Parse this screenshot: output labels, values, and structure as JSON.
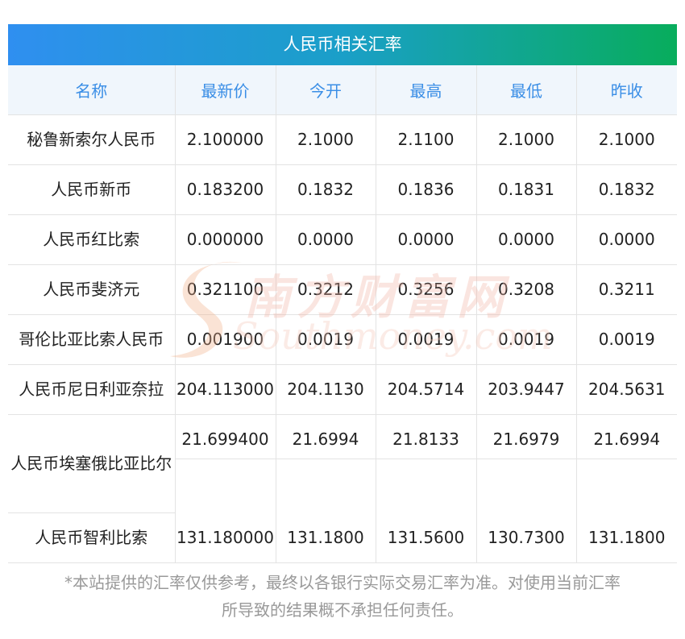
{
  "title": "人民币相关汇率",
  "columns": [
    "名称",
    "最新价",
    "今开",
    "最高",
    "最低",
    "昨收"
  ],
  "rows": [
    {
      "name": "秘鲁新索尔人民币",
      "latest": "2.100000",
      "open": "2.1000",
      "high": "2.1100",
      "low": "2.1000",
      "prev_close": "2.1000"
    },
    {
      "name": "人民币新币",
      "latest": "0.183200",
      "open": "0.1832",
      "high": "0.1836",
      "low": "0.1831",
      "prev_close": "0.1832"
    },
    {
      "name": "人民币红比索",
      "latest": "0.000000",
      "open": "0.0000",
      "high": "0.0000",
      "low": "0.0000",
      "prev_close": "0.0000"
    },
    {
      "name": "人民币斐济元",
      "latest": "0.321100",
      "open": "0.3212",
      "high": "0.3256",
      "low": "0.3208",
      "prev_close": "0.3211"
    },
    {
      "name": "哥伦比亚比索人民币",
      "latest": "0.001900",
      "open": "0.0019",
      "high": "0.0019",
      "low": "0.0019",
      "prev_close": "0.0019"
    },
    {
      "name": "人民币尼日利亚奈拉",
      "latest": "204.113000",
      "open": "204.1130",
      "high": "204.5714",
      "low": "203.9447",
      "prev_close": "204.5631"
    },
    {
      "name": "人民币埃塞俄比亚比尔",
      "latest": "21.699400",
      "open": "21.6994",
      "high": "21.8133",
      "low": "21.6979",
      "prev_close": "21.6994"
    },
    {
      "name": "人民币智利比索",
      "latest": "131.180000",
      "open": "131.1800",
      "high": "131.5600",
      "low": "130.7300",
      "prev_close": "131.1800"
    }
  ],
  "watermark": {
    "cn": "南方财富网",
    "en": "Southmoney.com"
  },
  "disclaimer": {
    "line1": "*本站提供的汇率仅供参考，最终以各银行实际交易汇率为准。对使用当前汇率",
    "line2": "所导致的结果概不承担任何责任。"
  },
  "colors": {
    "header_text": "#3a8ee6",
    "header_bg": "#f0f6fc",
    "title_gradient_start": "#2f8ff0",
    "title_gradient_end": "#08ad5c"
  }
}
